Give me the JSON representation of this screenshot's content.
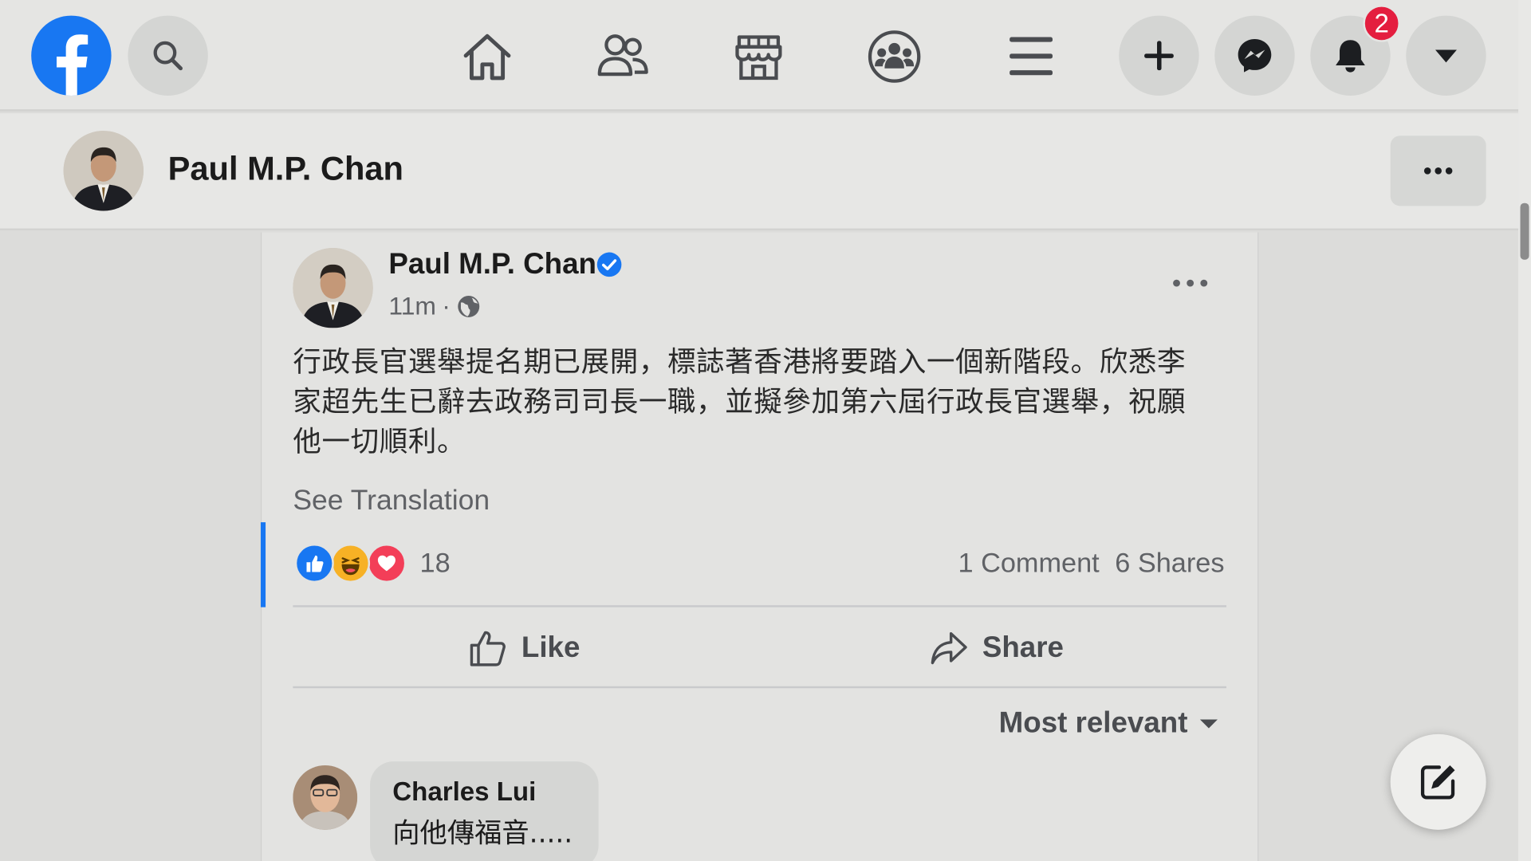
{
  "topbar": {
    "notifications_badge": "2"
  },
  "page_header": {
    "title": "Paul M.P. Chan"
  },
  "post": {
    "author": "Paul M.P. Chan",
    "timestamp": "11m",
    "separator": "·",
    "text_lines": [
      "行政長官選舉提名期已展開，標誌著香港將要踏入一個新階段。欣悉李",
      "家超先生已辭去政務司司長一職，並擬參加第六屆行政長官選舉，祝願",
      "他一切順利。"
    ],
    "see_translation": "See Translation",
    "reaction_count": "18",
    "comments_count": "1 Comment",
    "shares_count": "6 Shares",
    "like_label": "Like",
    "share_label": "Share",
    "sort_label": "Most relevant"
  },
  "comment": {
    "author": "Charles Lui",
    "text": "向他傳福音....."
  },
  "colors": {
    "brand": "#1877f2",
    "badge": "#e41e3f",
    "like_blue": "#1877f2",
    "love_red": "#f33e58",
    "haha_yellow": "#f7b125"
  }
}
